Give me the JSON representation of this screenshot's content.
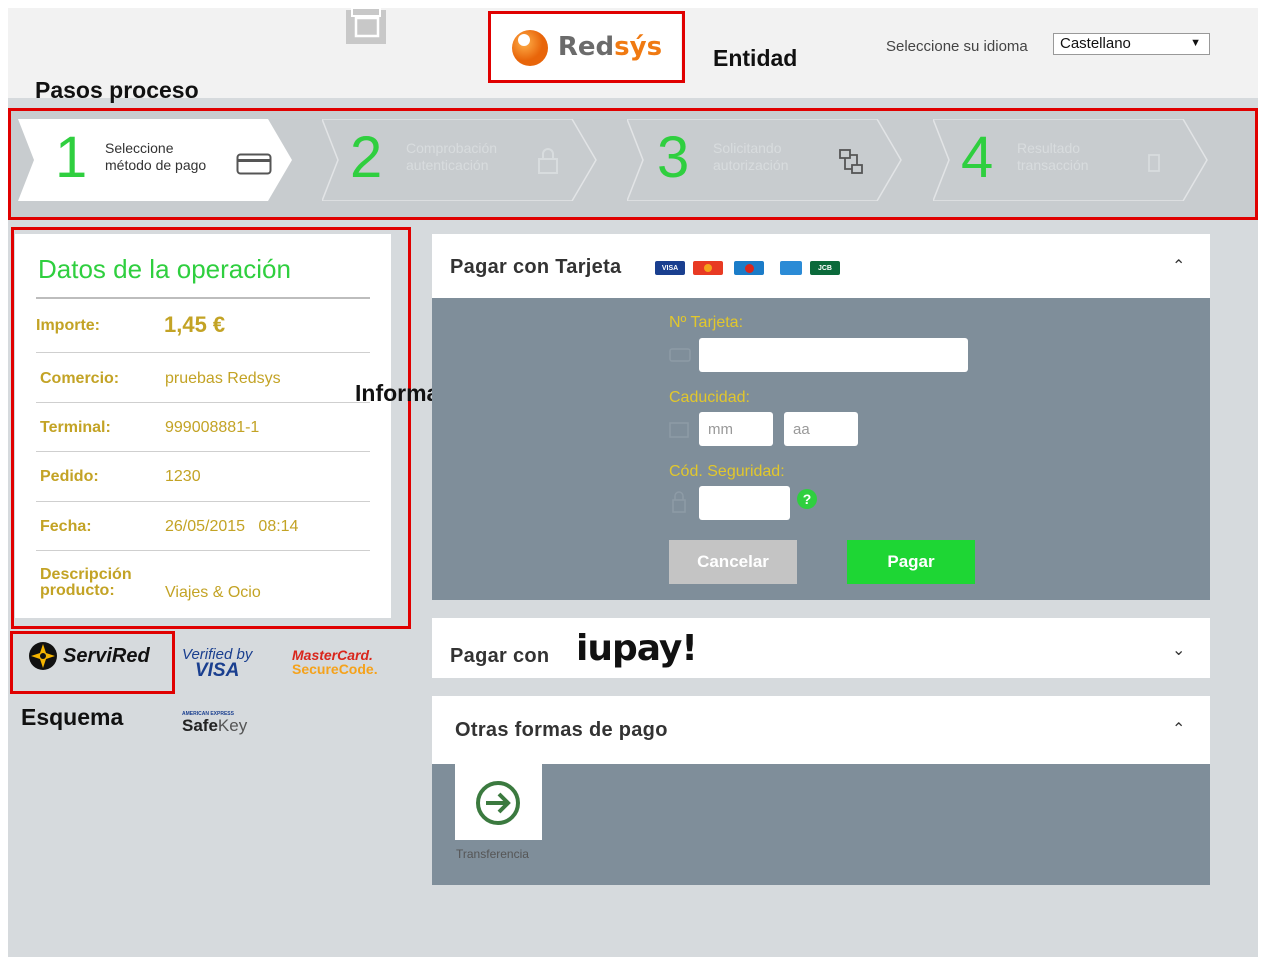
{
  "header": {
    "logo_text_main": "Red",
    "logo_text_accent": "sýs",
    "annotation_entidad": "Entidad",
    "language_label": "Seleccione su idioma",
    "language_selected": "Castellano"
  },
  "annotations": {
    "pasos": "Pasos proceso",
    "informacion": "Información operación",
    "esquema": "Esquema"
  },
  "steps": [
    {
      "number": "1",
      "label_line1": "Seleccione",
      "label_line2": "método de pago",
      "icon": "card-icon",
      "active": true
    },
    {
      "number": "2",
      "label_line1": "Comprobación",
      "label_line2": "autenticación",
      "icon": "lock-icon",
      "active": false
    },
    {
      "number": "3",
      "label_line1": "Solicitando",
      "label_line2": "autorización",
      "icon": "network-icon",
      "active": false
    },
    {
      "number": "4",
      "label_line1": "Resultado",
      "label_line2": "transacción",
      "icon": "receipt-icon",
      "active": false
    }
  ],
  "operation": {
    "title": "Datos de la operación",
    "rows": [
      {
        "label": "Importe:",
        "value": "1,45 €"
      },
      {
        "label": "Comercio:",
        "value": "pruebas Redsys"
      },
      {
        "label": "Terminal:",
        "value": "999008881-1"
      },
      {
        "label": "Pedido:",
        "value": "1230"
      },
      {
        "label": "Fecha:",
        "value": "26/05/2015   08:14"
      },
      {
        "label_line1": "Descripción",
        "label_line2": "producto:",
        "value": "Viajes & Ocio"
      }
    ]
  },
  "schemes": {
    "servired": "ServiRed",
    "verified_line1": "Verified by",
    "verified_line2": "VISA",
    "mastercard_line1": "MasterCard.",
    "mastercard_line2": "SecureCode.",
    "amex_small": "AMERICAN EXPRESS",
    "safekey_main": "Safe",
    "safekey_accent": "Key"
  },
  "card_payment": {
    "title": "Pagar con Tarjeta",
    "brands": [
      "VISA",
      "MC",
      "Maestro",
      "AMEX",
      "JCB"
    ],
    "card_number_label": "Nº Tarjeta:",
    "expiry_label": "Caducidad:",
    "month_placeholder": "mm",
    "year_placeholder": "aa",
    "cvv_label": "Cód. Seguridad:",
    "help_glyph": "?",
    "cancel_label": "Cancelar",
    "pay_label": "Pagar"
  },
  "iupay": {
    "prefix": "Pagar con",
    "brand": "iupay!"
  },
  "other": {
    "title": "Otras formas de pago",
    "transfer_label": "Transferencia"
  },
  "colors": {
    "accent_green": "#2fcf3f",
    "gold": "#c3a325",
    "annotation_red": "#e00000",
    "panel_slate": "#7f8e9a"
  }
}
